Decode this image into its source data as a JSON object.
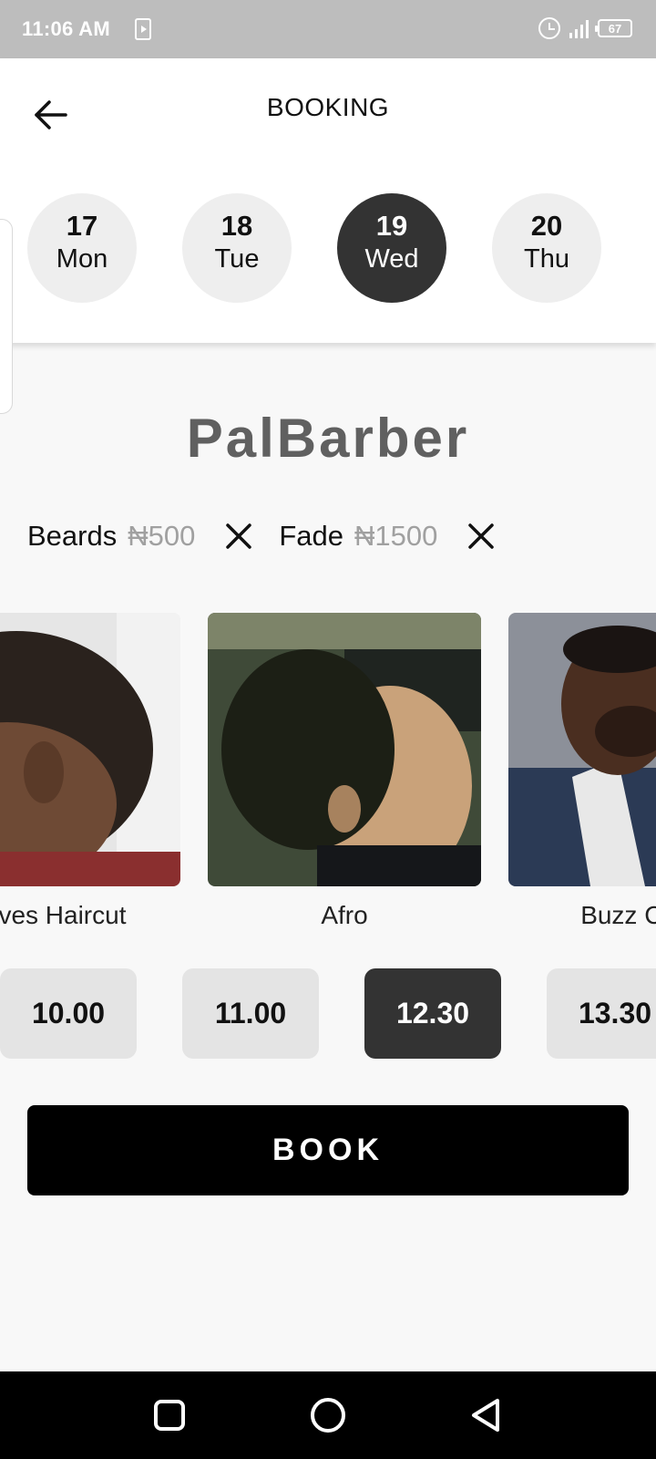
{
  "status_bar": {
    "time": "11:06 AM",
    "battery": "67",
    "icons": [
      "screen-record-icon",
      "alarm-icon",
      "signal-icon",
      "battery-icon"
    ]
  },
  "header": {
    "title": "BOOKING",
    "back_icon": "arrow-left-icon"
  },
  "days": [
    {
      "num": "17",
      "name": "Mon",
      "selected": false
    },
    {
      "num": "18",
      "name": "Tue",
      "selected": false
    },
    {
      "num": "19",
      "name": "Wed",
      "selected": true
    },
    {
      "num": "20",
      "name": "Thu",
      "selected": false
    }
  ],
  "shop": {
    "name": "PalBarber"
  },
  "services": [
    {
      "name": "Beards",
      "price": "₦500"
    },
    {
      "name": "Fade",
      "price": "₦1500"
    }
  ],
  "styles": [
    {
      "label": "Waves Haircut"
    },
    {
      "label": "Afro"
    },
    {
      "label": "Buzz Cut w"
    }
  ],
  "times": [
    {
      "label": "10.00",
      "selected": false
    },
    {
      "label": "11.00",
      "selected": false
    },
    {
      "label": "12.30",
      "selected": true
    },
    {
      "label": "13.30",
      "selected": false
    }
  ],
  "book": {
    "label": "BOOK"
  },
  "nav": [
    "recents-square-icon",
    "home-circle-icon",
    "back-triangle-icon"
  ],
  "colors": {
    "selected": "#333333",
    "chip": "#eeeeee",
    "price_muted": "#a0a0a0",
    "shop_name": "#606060",
    "button": "#000000"
  }
}
